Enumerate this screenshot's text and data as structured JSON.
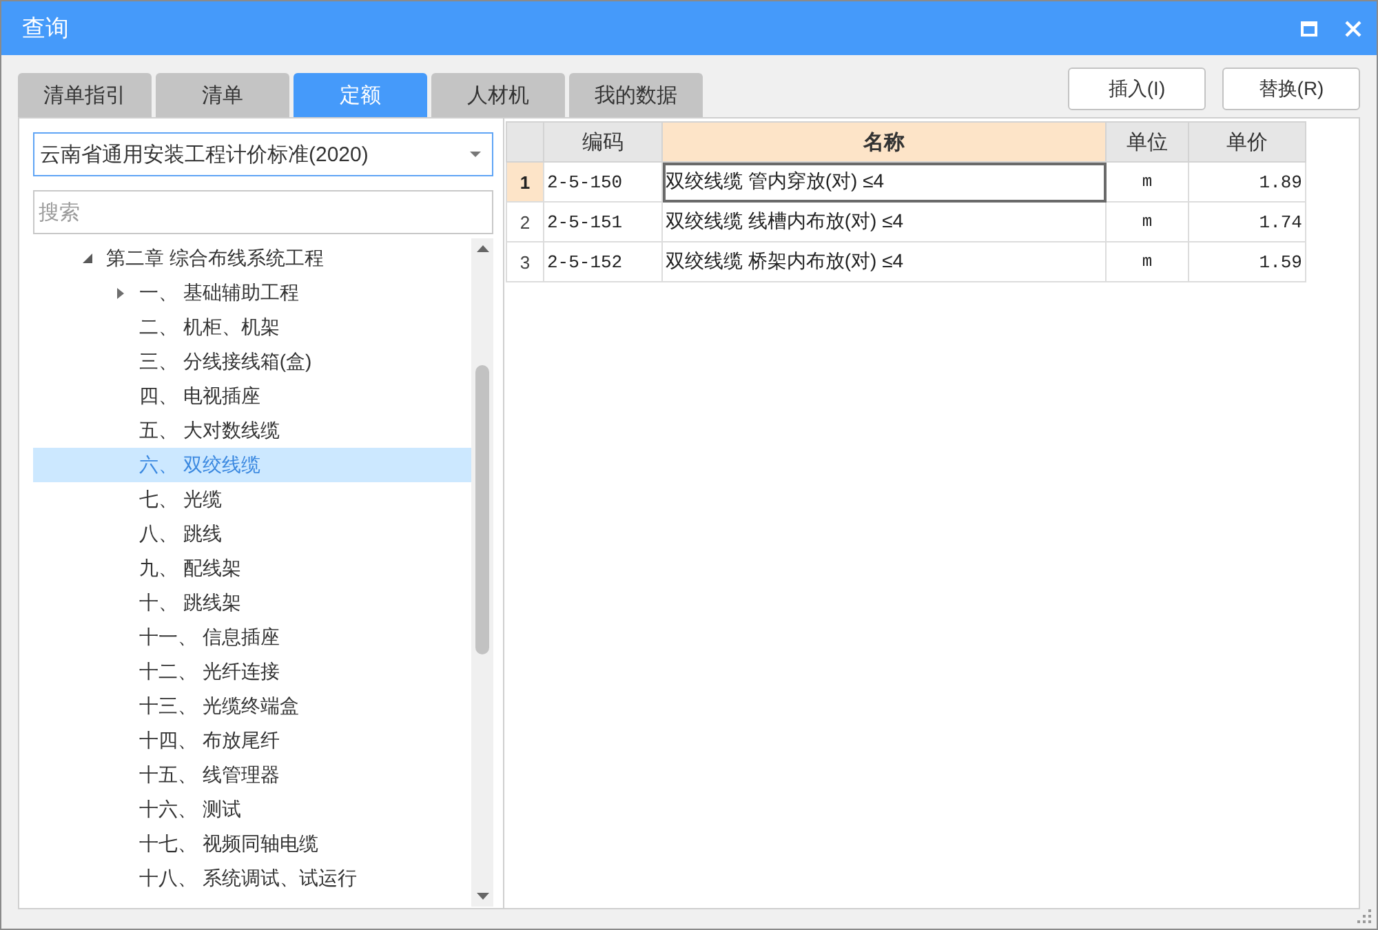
{
  "window": {
    "title": "查询"
  },
  "tabs": [
    {
      "label": "清单指引",
      "selected": false
    },
    {
      "label": "清单",
      "selected": false
    },
    {
      "label": "定额",
      "selected": true
    },
    {
      "label": "人材机",
      "selected": false
    },
    {
      "label": "我的数据",
      "selected": false
    }
  ],
  "buttons": [
    "插入(I)",
    "替换(R)"
  ],
  "standard_select": {
    "value": "云南省通用安装工程计价标准(2020)"
  },
  "search": {
    "placeholder": "搜索"
  },
  "tree": [
    {
      "label": "第二章 综合布线系统工程",
      "expanded": true,
      "selected": false,
      "children": [
        {
          "label": "一、 基础辅助工程",
          "expanded": false,
          "selected": false
        },
        {
          "label": "二、 机柜、机架",
          "selected": false
        },
        {
          "label": "三、 分线接线箱(盒)",
          "selected": false
        },
        {
          "label": "四、 电视插座",
          "selected": false
        },
        {
          "label": "五、 大对数线缆",
          "selected": false
        },
        {
          "label": "六、 双绞线缆",
          "selected": true
        },
        {
          "label": "七、 光缆",
          "selected": false
        },
        {
          "label": "八、 跳线",
          "selected": false
        },
        {
          "label": "九、 配线架",
          "selected": false
        },
        {
          "label": "十、 跳线架",
          "selected": false
        },
        {
          "label": "十一、 信息插座",
          "selected": false
        },
        {
          "label": "十二、 光纤连接",
          "selected": false
        },
        {
          "label": "十三、 光缆终端盒",
          "selected": false
        },
        {
          "label": "十四、 布放尾纤",
          "selected": false
        },
        {
          "label": "十五、 线管理器",
          "selected": false
        },
        {
          "label": "十六、 测试",
          "selected": false
        },
        {
          "label": "十七、 视频同轴电缆",
          "selected": false
        },
        {
          "label": "十八、 系统调试、试运行",
          "selected": false
        }
      ]
    }
  ],
  "table": {
    "columns": [
      {
        "label": "编码",
        "selected": false
      },
      {
        "label": "名称",
        "selected": true
      },
      {
        "label": "单位",
        "selected": false
      },
      {
        "label": "单价",
        "selected": false
      }
    ],
    "rows": [
      {
        "number": "1",
        "code": "2-5-150",
        "name": "双绞线缆 管内穿放(对) ≤4",
        "unit": "m",
        "price": "1.89",
        "selected": true
      },
      {
        "number": "2",
        "code": "2-5-151",
        "name": "双绞线缆 线槽内布放(对) ≤4",
        "unit": "m",
        "price": "1.74",
        "selected": false
      },
      {
        "number": "3",
        "code": "2-5-152",
        "name": "双绞线缆 桥架内布放(对) ≤4",
        "unit": "m",
        "price": "1.59",
        "selected": false
      }
    ]
  }
}
